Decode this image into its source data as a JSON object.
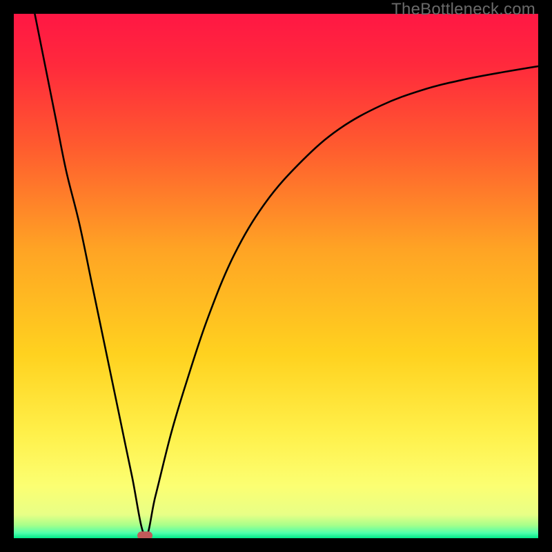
{
  "watermark": "TheBottleneck.com",
  "chart_data": {
    "type": "line",
    "title": "",
    "xlabel": "",
    "ylabel": "",
    "xlim": [
      0,
      100
    ],
    "ylim": [
      0,
      100
    ],
    "grid": false,
    "legend": false,
    "background_gradient": {
      "direction": "vertical",
      "stops": [
        {
          "pos": 0.0,
          "color": "#ff1744"
        },
        {
          "pos": 0.1,
          "color": "#ff2a3c"
        },
        {
          "pos": 0.25,
          "color": "#ff5a2f"
        },
        {
          "pos": 0.45,
          "color": "#ffa424"
        },
        {
          "pos": 0.65,
          "color": "#ffd21f"
        },
        {
          "pos": 0.8,
          "color": "#fff04a"
        },
        {
          "pos": 0.9,
          "color": "#fcff72"
        },
        {
          "pos": 0.955,
          "color": "#e8ff86"
        },
        {
          "pos": 0.975,
          "color": "#a8ff8a"
        },
        {
          "pos": 0.99,
          "color": "#4fffab"
        },
        {
          "pos": 1.0,
          "color": "#00e989"
        }
      ]
    },
    "marker": {
      "x": 25,
      "y": 0.5,
      "color": "#c25a5a",
      "shape": "rounded-pill"
    },
    "series": [
      {
        "name": "curve",
        "color": "#000000",
        "points": [
          {
            "x": 4.0,
            "y": 100.0
          },
          {
            "x": 6.0,
            "y": 90.0
          },
          {
            "x": 8.0,
            "y": 80.0
          },
          {
            "x": 10.0,
            "y": 70.0
          },
          {
            "x": 12.5,
            "y": 60.0
          },
          {
            "x": 15.0,
            "y": 48.0
          },
          {
            "x": 17.5,
            "y": 36.0
          },
          {
            "x": 20.0,
            "y": 24.0
          },
          {
            "x": 22.5,
            "y": 12.0
          },
          {
            "x": 25.0,
            "y": 0.5
          },
          {
            "x": 27.0,
            "y": 8.0
          },
          {
            "x": 30.0,
            "y": 20.0
          },
          {
            "x": 33.0,
            "y": 30.0
          },
          {
            "x": 37.0,
            "y": 42.0
          },
          {
            "x": 42.0,
            "y": 54.0
          },
          {
            "x": 48.0,
            "y": 64.0
          },
          {
            "x": 55.0,
            "y": 72.0
          },
          {
            "x": 62.0,
            "y": 78.0
          },
          {
            "x": 70.0,
            "y": 82.5
          },
          {
            "x": 78.0,
            "y": 85.5
          },
          {
            "x": 86.0,
            "y": 87.5
          },
          {
            "x": 94.0,
            "y": 89.0
          },
          {
            "x": 100.0,
            "y": 90.0
          }
        ]
      }
    ]
  }
}
